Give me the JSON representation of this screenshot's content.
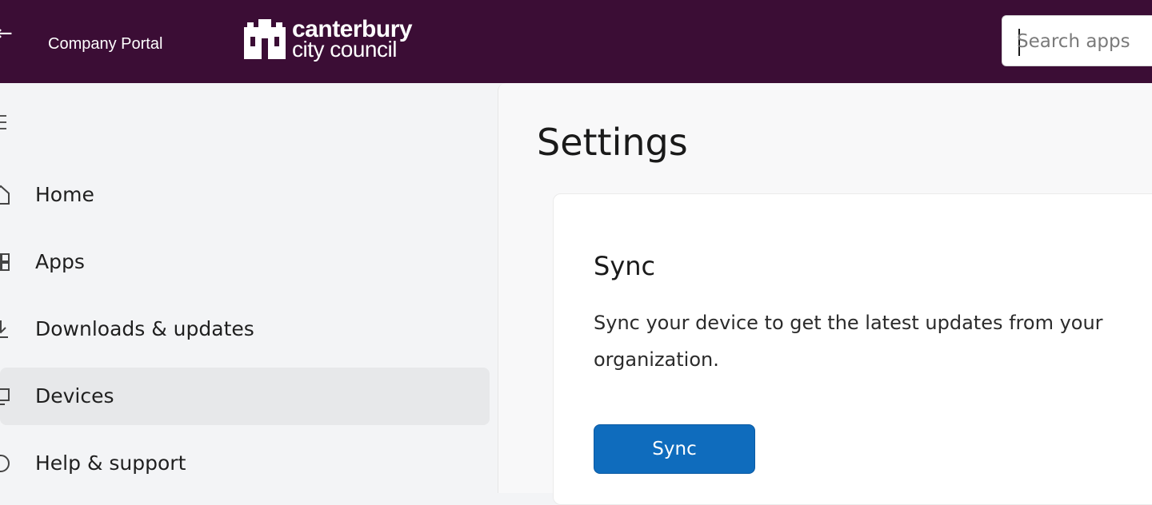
{
  "window": {
    "app_title": "Company Portal",
    "back_icon": "back-arrow-icon"
  },
  "logo": {
    "name": "canterbury",
    "sub": "city council"
  },
  "search": {
    "placeholder": "Search apps",
    "value": ""
  },
  "sidebar": {
    "menu_icon": "hamburger-icon",
    "items": [
      {
        "label": "Home",
        "icon": "home-icon",
        "selected": false
      },
      {
        "label": "Apps",
        "icon": "apps-icon",
        "selected": false
      },
      {
        "label": "Downloads & updates",
        "icon": "download-icon",
        "selected": false
      },
      {
        "label": "Devices",
        "icon": "device-icon",
        "selected": true
      },
      {
        "label": "Help & support",
        "icon": "help-icon",
        "selected": false
      }
    ]
  },
  "main": {
    "title": "Settings",
    "sync_card": {
      "title": "Sync",
      "description": "Sync your device to get the latest updates from your organization.",
      "button_label": "Sync"
    }
  },
  "colors": {
    "titlebar": "#3b0d35",
    "accent": "#0f6cbd",
    "selected_nav": "#e7e8ea"
  }
}
